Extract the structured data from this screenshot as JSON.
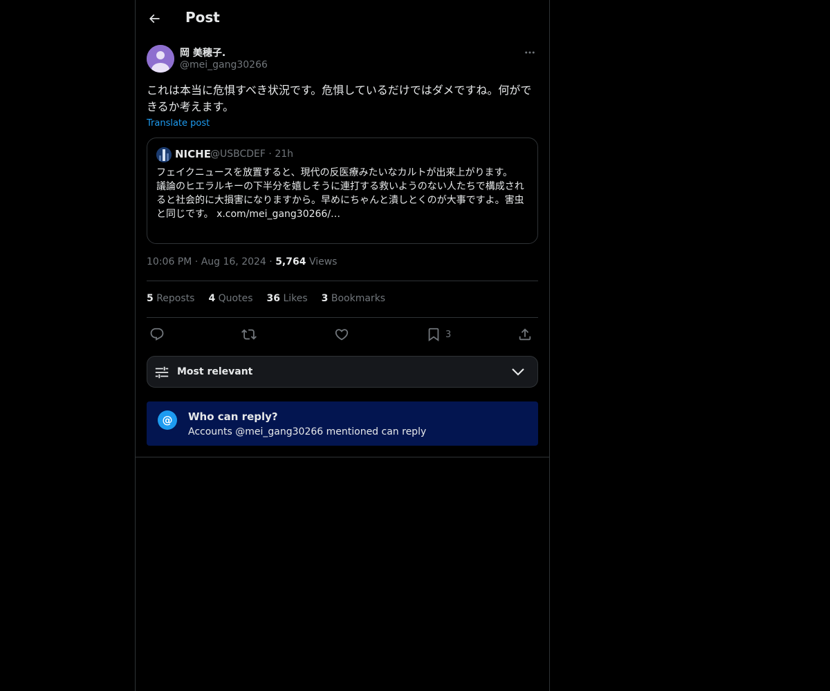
{
  "header": {
    "title": "Post",
    "back_icon": "arrow-left-icon"
  },
  "author": {
    "name": "岡 美穂子.",
    "handle": "@mei_gang30266"
  },
  "post": {
    "text": "これは本当に危惧すべき状況です。危惧しているだけではダメですね。何ができるか考えます。",
    "translate_label": "Translate post"
  },
  "quote": {
    "name": "NICHE",
    "handle": "@USBCDEF",
    "time": "21h",
    "text_lines": [
      "フェイクニュースを放置すると、現代の反医療みたいなカルトが出来上がります。",
      "議論のヒエラルキーの下半分を嬉しそうに連打する救いようのない人たちで構成されると社会的に大損害になりますから。早めにちゃんと潰しとくのが大事ですよ。害虫と同じです。"
    ],
    "link": "x.com/mei_gang30266/…"
  },
  "meta": {
    "time": "10:06 PM",
    "date": "Aug 16, 2024",
    "views_count": "5,764",
    "views_label": "Views"
  },
  "stats": {
    "reposts_count": "5",
    "reposts_label": "Reposts",
    "quotes_count": "4",
    "quotes_label": "Quotes",
    "likes_count": "36",
    "likes_label": "Likes",
    "bookmarks_count": "3",
    "bookmarks_label": "Bookmarks"
  },
  "actions": {
    "bookmark_count": "3"
  },
  "sort": {
    "label": "Most relevant"
  },
  "reply_restriction": {
    "title": "Who can reply?",
    "subtitle": "Accounts @mei_gang30266 mentioned can reply",
    "icon_glyph": "@"
  },
  "colors": {
    "background": "#000000",
    "accent": "#1d9bf0",
    "muted": "#71767b",
    "reply_box": "#031550"
  }
}
